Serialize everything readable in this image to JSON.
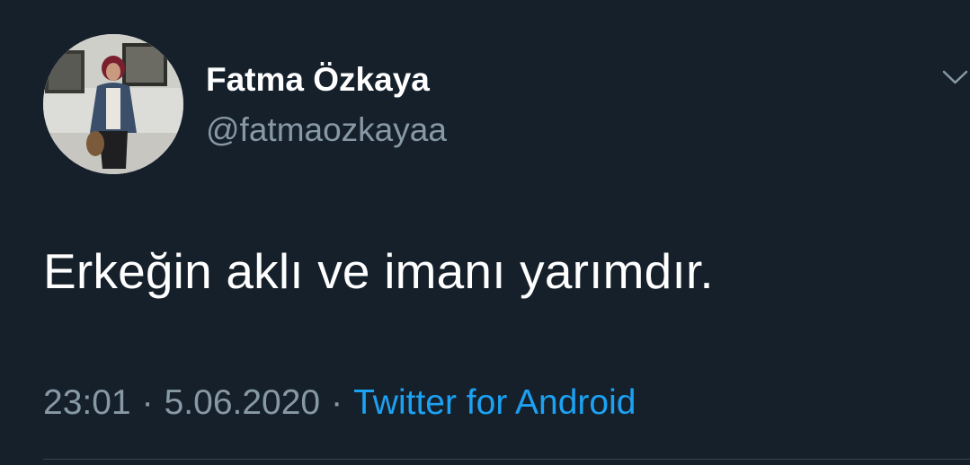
{
  "author": {
    "display_name": "Fatma Özkaya",
    "handle": "@fatmaozkayaa"
  },
  "tweet": {
    "text": "Erkeğin aklı ve imanı yarımdır.",
    "time": "23:01",
    "separator": "·",
    "date": "5.06.2020",
    "source": "Twitter for Android"
  },
  "icons": {
    "menu": "chevron-down-icon",
    "avatar": "profile-photo"
  },
  "colors": {
    "background": "#15202b",
    "text": "#ffffff",
    "muted": "#8899a6",
    "link": "#1da1f2"
  }
}
